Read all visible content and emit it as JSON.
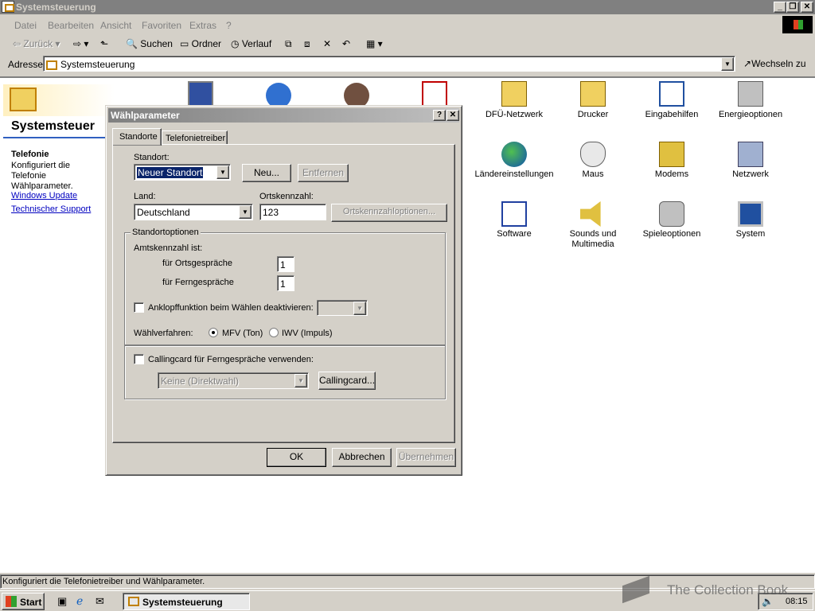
{
  "window": {
    "title": "Systemsteuerung"
  },
  "menu": [
    "Datei",
    "Bearbeiten",
    "Ansicht",
    "Favoriten",
    "Extras",
    "?"
  ],
  "toolbar": {
    "back": "Zurück",
    "search": "Suchen",
    "folders": "Ordner",
    "history": "Verlauf"
  },
  "address": {
    "label": "Adresse",
    "value": "Systemsteuerung",
    "go": "Wechseln zu"
  },
  "sidepanel": {
    "header": "Systemsteuer",
    "item_title": "Telefonie",
    "item_desc": "Konfiguriert die Telefonie Wählparameter.",
    "links": [
      "Windows Update",
      "Technischer Support"
    ]
  },
  "icons": [
    {
      "label": "DFÜ-Netzwerk",
      "icon": "network-dialup-icon"
    },
    {
      "label": "Drucker",
      "icon": "printer-icon"
    },
    {
      "label": "Eingabehilfen",
      "icon": "accessibility-icon"
    },
    {
      "label": "Energieoptionen",
      "icon": "power-icon"
    },
    {
      "label": "Ländereinstellungen",
      "icon": "globe-icon"
    },
    {
      "label": "Maus",
      "icon": "mouse-icon"
    },
    {
      "label": "Modems",
      "icon": "modem-icon"
    },
    {
      "label": "Netzwerk",
      "icon": "network-icon"
    },
    {
      "label": "Software",
      "icon": "software-icon"
    },
    {
      "label": "Sounds und Multimedia",
      "icon": "speaker-icon"
    },
    {
      "label": "Spieleoptionen",
      "icon": "joystick-icon"
    },
    {
      "label": "System",
      "icon": "computer-icon"
    }
  ],
  "dialog": {
    "title": "Wählparameter",
    "tabs": [
      "Standorte",
      "Telefonietreiber"
    ],
    "standort_label": "Standort:",
    "standort_value": "Neuer Standort",
    "new_button": "Neu...",
    "remove_button": "Entfernen",
    "land_label": "Land:",
    "land_value": "Deutschland",
    "ortskennzahl_label": "Ortskennzahl:",
    "ortskennzahl_value": "123",
    "ortskennzahl_options": "Ortskennzahloptionen...",
    "group_title": "Standortoptionen",
    "amtskennzahl_label": "Amtskennzahl ist:",
    "orts_label": "für Ortsgespräche",
    "orts_value": "1",
    "fern_label": "für Ferngespräche",
    "fern_value": "1",
    "anklopf_label": "Anklopffunktion beim Wählen deaktivieren:",
    "waehlverfahren_label": "Wählverfahren:",
    "mfv_label": "MFV (Ton)",
    "iwv_label": "IWV (Impuls)",
    "callingcard_check": "Callingcard für Ferngespräche verwenden:",
    "callingcard_value": "Keine (Direktwahl)",
    "callingcard_button": "Callingcard...",
    "ok": "OK",
    "cancel": "Abbrechen",
    "apply": "Übernehmen"
  },
  "status": {
    "text": "Konfiguriert die Telefonietreiber und Wählparameter."
  },
  "taskbar": {
    "start": "Start",
    "task": "Systemsteuerung",
    "clock": "08:15"
  },
  "watermark": "The Collection Book"
}
